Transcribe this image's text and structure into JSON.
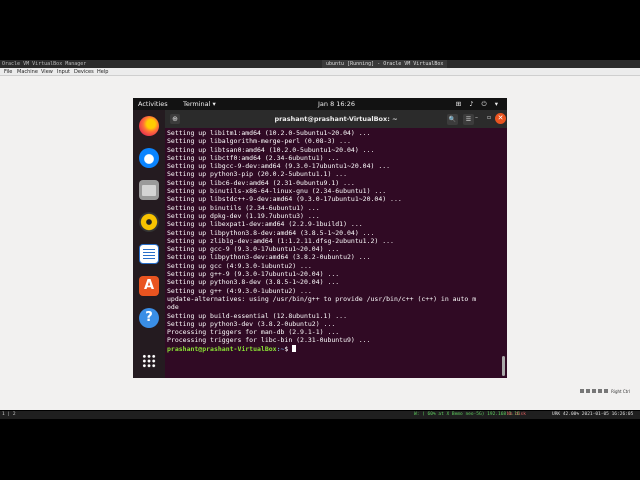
{
  "host": {
    "vbox_manager_title": "Oracle VM VirtualBox Manager",
    "vm_window_title": "ubuntu [Running] - Oracle VM VirtualBox",
    "menu": [
      "File",
      "Machine",
      "View",
      "Input",
      "Devices",
      "Help"
    ],
    "host_key": "Right Ctrl",
    "workspaces": "1 | 2",
    "status_network": "W: ( 60% at X Bemo neo-5G) 192.168.1.10",
    "status_disk": "No disk",
    "status_stats": "URK 42.00% 2021-01-05 16:26:05"
  },
  "topbar": {
    "activities": "Activities",
    "app_menu": "Terminal ▾",
    "clock": "Jan 8  16:26",
    "tray": "⊞ ♪ ⏻ ▾"
  },
  "dock": {
    "icons": [
      "firefox-icon",
      "thunderbird-icon",
      "files-icon",
      "rhythmbox-icon",
      "writer-icon",
      "software-icon",
      "help-icon",
      "show-apps-icon"
    ],
    "store_glyph": "A",
    "help_glyph": "?"
  },
  "terminal": {
    "title": "prashant@prashant-VirtualBox: ~",
    "new_tab_glyph": "⊕",
    "search_glyph": "🔍",
    "menu_glyph": "☰",
    "min_glyph": "–",
    "max_glyph": "▫",
    "close_glyph": "✕",
    "lines": [
      "Setting up libitm1:amd64 (10.2.0-5ubuntu1~20.04) ...",
      "Setting up libalgorithm-merge-perl (0.08-3) ...",
      "Setting up libtsan0:amd64 (10.2.0-5ubuntu1~20.04) ...",
      "Setting up libctf0:amd64 (2.34-6ubuntu1) ...",
      "Setting up libgcc-9-dev:amd64 (9.3.0-17ubuntu1~20.04) ...",
      "Setting up python3-pip (20.0.2-5ubuntu1.1) ...",
      "Setting up libc6-dev:amd64 (2.31-0ubuntu9.1) ...",
      "Setting up binutils-x86-64-linux-gnu (2.34-6ubuntu1) ...",
      "Setting up libstdc++-9-dev:amd64 (9.3.0-17ubuntu1~20.04) ...",
      "Setting up binutils (2.34-6ubuntu1) ...",
      "Setting up dpkg-dev (1.19.7ubuntu3) ...",
      "Setting up libexpat1-dev:amd64 (2.2.9-1build1) ...",
      "Setting up libpython3.8-dev:amd64 (3.8.5-1~20.04) ...",
      "Setting up zlib1g-dev:amd64 (1:1.2.11.dfsg-2ubuntu1.2) ...",
      "Setting up gcc-9 (9.3.0-17ubuntu1~20.04) ...",
      "Setting up libpython3-dev:amd64 (3.8.2-0ubuntu2) ...",
      "Setting up gcc (4:9.3.0-1ubuntu2) ...",
      "Setting up g++-9 (9.3.0-17ubuntu1~20.04) ...",
      "Setting up python3.8-dev (3.8.5-1~20.04) ...",
      "Setting up g++ (4:9.3.0-1ubuntu2) ...",
      "update-alternatives: using /usr/bin/g++ to provide /usr/bin/c++ (c++) in auto m",
      "ode",
      "Setting up build-essential (12.8ubuntu1.1) ...",
      "Setting up python3-dev (3.8.2-0ubuntu2) ...",
      "Processing triggers for man-db (2.9.1-1) ...",
      "Processing triggers for libc-bin (2.31-0ubuntu9) ..."
    ],
    "prompt_user": "prashant@prashant-VirtualBox",
    "prompt_path": ":~",
    "prompt_symbol": "$ "
  }
}
